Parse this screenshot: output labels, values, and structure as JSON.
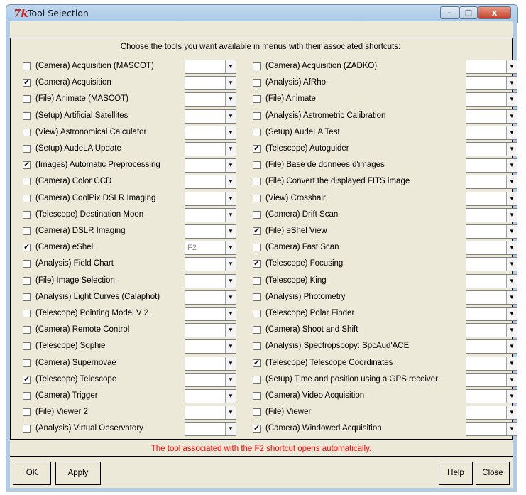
{
  "window": {
    "title": "Tool Selection",
    "icon": "tk-icon",
    "controls": {
      "minimize": "–",
      "maximize": "□",
      "close": "x"
    }
  },
  "heading": "Choose the tools you want available in menus with their associated shortcuts:",
  "left_tools": [
    {
      "label": "(Camera)  Acquisition (MASCOT)",
      "checked": false,
      "shortcut": ""
    },
    {
      "label": "(Camera)  Acquisition",
      "checked": true,
      "shortcut": ""
    },
    {
      "label": "(File)  Animate (MASCOT)",
      "checked": false,
      "shortcut": ""
    },
    {
      "label": "(Setup)  Artificial Satellites",
      "checked": false,
      "shortcut": ""
    },
    {
      "label": "(View)  Astronomical Calculator",
      "checked": false,
      "shortcut": ""
    },
    {
      "label": "(Setup)  AudeLA Update",
      "checked": false,
      "shortcut": ""
    },
    {
      "label": "(Images)  Automatic Preprocessing",
      "checked": true,
      "shortcut": ""
    },
    {
      "label": "(Camera)  Color CCD",
      "checked": false,
      "shortcut": ""
    },
    {
      "label": "(Camera)  CoolPix DSLR Imaging",
      "checked": false,
      "shortcut": ""
    },
    {
      "label": "(Telescope)  Destination Moon",
      "checked": false,
      "shortcut": ""
    },
    {
      "label": "(Camera)  DSLR Imaging",
      "checked": false,
      "shortcut": ""
    },
    {
      "label": "(Camera)  eShel",
      "checked": true,
      "shortcut": "F2"
    },
    {
      "label": "(Analysis)  Field Chart",
      "checked": false,
      "shortcut": ""
    },
    {
      "label": "(File)  Image Selection",
      "checked": false,
      "shortcut": ""
    },
    {
      "label": "(Analysis)  Light Curves (Calaphot)",
      "checked": false,
      "shortcut": ""
    },
    {
      "label": "(Telescope)  Pointing Model V 2",
      "checked": false,
      "shortcut": ""
    },
    {
      "label": "(Camera)  Remote Control",
      "checked": false,
      "shortcut": ""
    },
    {
      "label": "(Telescope)  Sophie",
      "checked": false,
      "shortcut": ""
    },
    {
      "label": "(Camera)  Supernovae",
      "checked": false,
      "shortcut": ""
    },
    {
      "label": "(Telescope)  Telescope",
      "checked": true,
      "shortcut": ""
    },
    {
      "label": "(Camera)  Trigger",
      "checked": false,
      "shortcut": ""
    },
    {
      "label": "(File)  Viewer 2",
      "checked": false,
      "shortcut": ""
    },
    {
      "label": "(Analysis)  Virtual Observatory",
      "checked": false,
      "shortcut": ""
    }
  ],
  "right_tools": [
    {
      "label": "(Camera)  Acquisition (ZADKO)",
      "checked": false,
      "shortcut": ""
    },
    {
      "label": "(Analysis)  AfRho",
      "checked": false,
      "shortcut": ""
    },
    {
      "label": "(File)  Animate",
      "checked": false,
      "shortcut": ""
    },
    {
      "label": "(Analysis)  Astrometric Calibration",
      "checked": false,
      "shortcut": ""
    },
    {
      "label": "(Setup)  AudeLA Test",
      "checked": false,
      "shortcut": ""
    },
    {
      "label": "(Telescope)  Autoguider",
      "checked": true,
      "shortcut": ""
    },
    {
      "label": "(File)  Base de données d'images",
      "checked": false,
      "shortcut": ""
    },
    {
      "label": "(File)  Convert the displayed FITS image",
      "checked": false,
      "shortcut": ""
    },
    {
      "label": "(View)  Crosshair",
      "checked": false,
      "shortcut": ""
    },
    {
      "label": "(Camera)  Drift Scan",
      "checked": false,
      "shortcut": ""
    },
    {
      "label": "(File)  eShel View",
      "checked": true,
      "shortcut": ""
    },
    {
      "label": "(Camera)  Fast Scan",
      "checked": false,
      "shortcut": ""
    },
    {
      "label": "(Telescope)  Focusing",
      "checked": true,
      "shortcut": ""
    },
    {
      "label": "(Telescope)  King",
      "checked": false,
      "shortcut": ""
    },
    {
      "label": "(Analysis)  Photometry",
      "checked": false,
      "shortcut": ""
    },
    {
      "label": "(Telescope)  Polar Finder",
      "checked": false,
      "shortcut": ""
    },
    {
      "label": "(Camera)  Shoot and Shift",
      "checked": false,
      "shortcut": ""
    },
    {
      "label": "(Analysis)  Spectropscopy: SpcAud'ACE",
      "checked": false,
      "shortcut": ""
    },
    {
      "label": "(Telescope)  Telescope Coordinates",
      "checked": true,
      "shortcut": ""
    },
    {
      "label": "(Setup)  Time and position using a GPS receiver",
      "checked": false,
      "shortcut": ""
    },
    {
      "label": "(Camera)  Video Acquisition",
      "checked": false,
      "shortcut": ""
    },
    {
      "label": "(File)  Viewer",
      "checked": false,
      "shortcut": ""
    },
    {
      "label": "(Camera)  Windowed Acquisition",
      "checked": true,
      "shortcut": ""
    }
  ],
  "info_message": "The tool associated with the F2 shortcut opens automatically.",
  "buttons": {
    "ok": "OK",
    "apply": "Apply",
    "help": "Help",
    "close": "Close"
  },
  "colors": {
    "info_text": "#ff0000",
    "dialog_bg": "#ece9d8"
  }
}
